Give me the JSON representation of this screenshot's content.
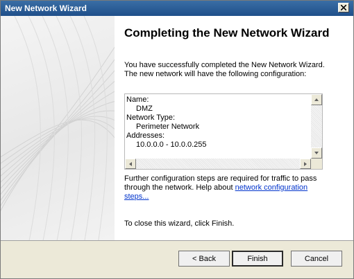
{
  "window": {
    "title": "New Network Wizard",
    "close_icon": "close-icon"
  },
  "content": {
    "heading": "Completing the New Network Wizard",
    "intro": "You have successfully completed the New Network Wizard. The new network will have the following configuration:"
  },
  "config": {
    "name_label": "Name:",
    "name_value": "DMZ",
    "type_label": "Network Type:",
    "type_value": "Perimeter Network",
    "addresses_label": "Addresses:",
    "addresses_value": "10.0.0.0 - 10.0.0.255"
  },
  "note": {
    "text": "Further configuration steps are required for traffic to pass through the network. Help about ",
    "link": "network configuration steps..."
  },
  "finish_text": "To close this wizard, click Finish.",
  "buttons": {
    "back": "< Back",
    "finish": "Finish",
    "cancel": "Cancel"
  }
}
